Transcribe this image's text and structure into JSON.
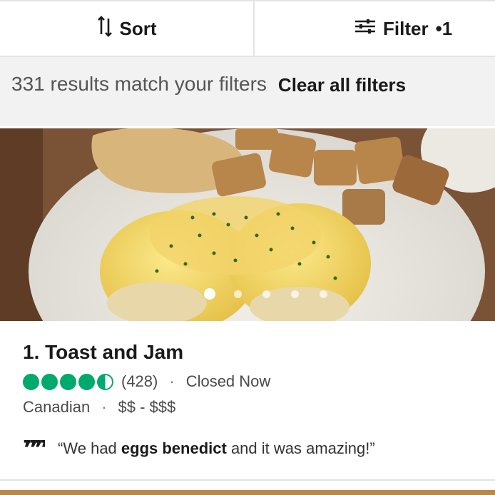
{
  "toolbar": {
    "sort_label": "Sort",
    "filter_label": "Filter",
    "filter_dot": "•",
    "filter_count": "1"
  },
  "results": {
    "count": "331",
    "text": " results match your filters",
    "clear_label": "Clear all filters"
  },
  "carousel": {
    "dot_count": 5,
    "active_index": 0
  },
  "listing": {
    "name": "1. Toast and Jam",
    "rating": 4.5,
    "review_count": "(428)",
    "separator": "·",
    "status": "Closed Now",
    "cuisine": "Canadian",
    "price": "$$ - $$$",
    "quote_open": "“We had ",
    "quote_bold": "eggs benedict",
    "quote_close": " and it was amazing!”"
  },
  "colors": {
    "rating_green": "#00aa6c",
    "results_bg": "#f2f2f2"
  }
}
